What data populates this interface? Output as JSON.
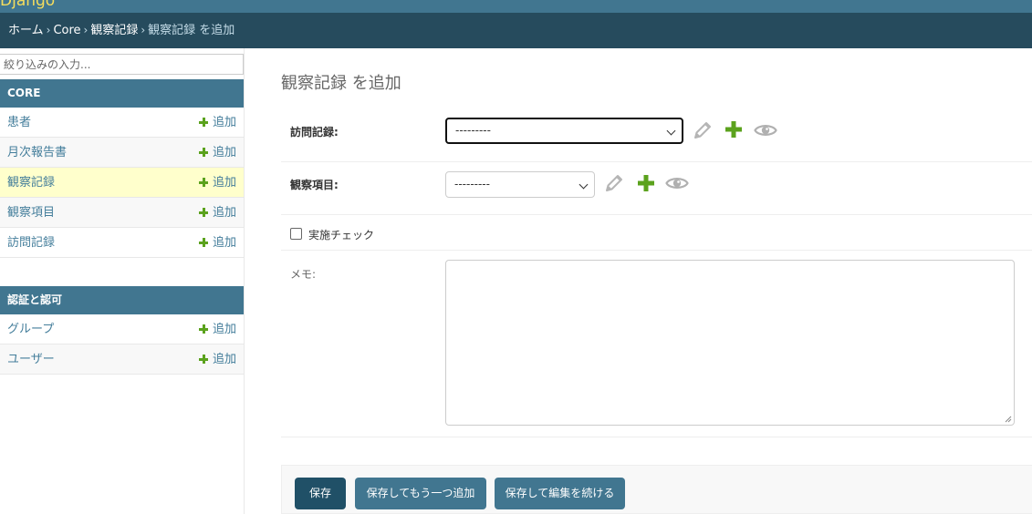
{
  "header": {
    "brand": "Django"
  },
  "breadcrumbs": {
    "home": "ホーム",
    "app": "Core",
    "model": "観察記録",
    "current": "観察記録 を追加",
    "separator": "›"
  },
  "sidebar": {
    "filter_placeholder": "絞り込みの入力...",
    "modules": [
      {
        "caption": "CORE",
        "models": [
          {
            "name": "患者",
            "add": "追加"
          },
          {
            "name": "月次報告書",
            "add": "追加"
          },
          {
            "name": "観察記録",
            "add": "追加",
            "current": true
          },
          {
            "name": "観察項目",
            "add": "追加"
          },
          {
            "name": "訪問記録",
            "add": "追加"
          }
        ]
      },
      {
        "caption": "認証と認可",
        "models": [
          {
            "name": "グループ",
            "add": "追加"
          },
          {
            "name": "ユーザー",
            "add": "追加"
          }
        ]
      }
    ]
  },
  "form": {
    "title": "観察記録 を追加",
    "visit_record": {
      "label": "訪問記録:",
      "value": "---------"
    },
    "observation_item": {
      "label": "観察項目:",
      "value": "---------"
    },
    "implemented": {
      "label": "実施チェック",
      "checked": false
    },
    "memo": {
      "label": "メモ:",
      "value": ""
    }
  },
  "submit": {
    "save": "保存",
    "save_add_another": "保存してもう一つ追加",
    "save_continue": "保存して編集を続ける"
  },
  "icons": {
    "change": "pencil-icon",
    "add": "plus-icon",
    "view": "eye-icon"
  },
  "colors": {
    "header": "#417690",
    "breadcrumbs": "#264b5d",
    "module_caption": "#417690",
    "current_row": "#ffffcc",
    "add_green": "#5ba21d",
    "link": "#447e9b",
    "default_button": "#205067",
    "secondary_button": "#417690"
  }
}
